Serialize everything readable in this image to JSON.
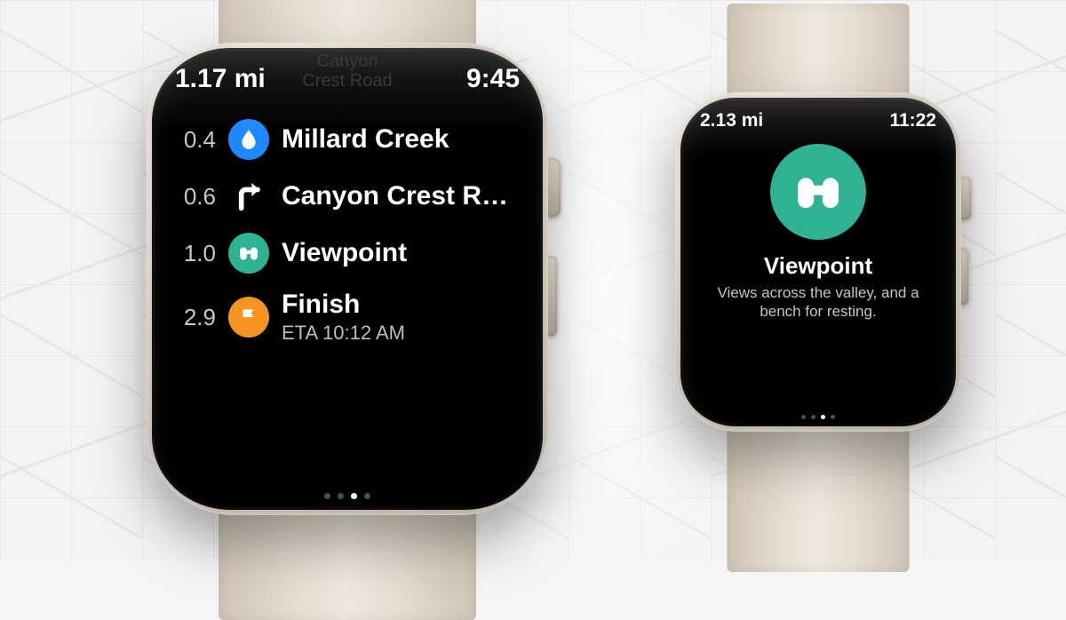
{
  "colors": {
    "water": "#1e88ff",
    "viewpoint": "#2fb193",
    "finish": "#f5941f"
  },
  "left": {
    "ghost": {
      "line1": "Canyon",
      "line2": "Crest Road"
    },
    "status": {
      "distance": "1.17 mi",
      "time": "9:45"
    },
    "steps": [
      {
        "dist": "0.4",
        "icon": "water",
        "label": "Millard Creek"
      },
      {
        "dist": "0.6",
        "icon": "turn",
        "label": "Canyon Crest R…"
      },
      {
        "dist": "1.0",
        "icon": "viewpoint",
        "label": "Viewpoint"
      },
      {
        "dist": "2.9",
        "icon": "finish",
        "label": "Finish",
        "sub": "ETA 10:12 AM"
      }
    ],
    "page": {
      "count": 4,
      "active": 2
    }
  },
  "right": {
    "status": {
      "distance": "2.13 mi",
      "time": "11:22"
    },
    "title": "Viewpoint",
    "desc": "Views across the valley, and a bench for resting.",
    "page": {
      "count": 4,
      "active": 2
    }
  }
}
